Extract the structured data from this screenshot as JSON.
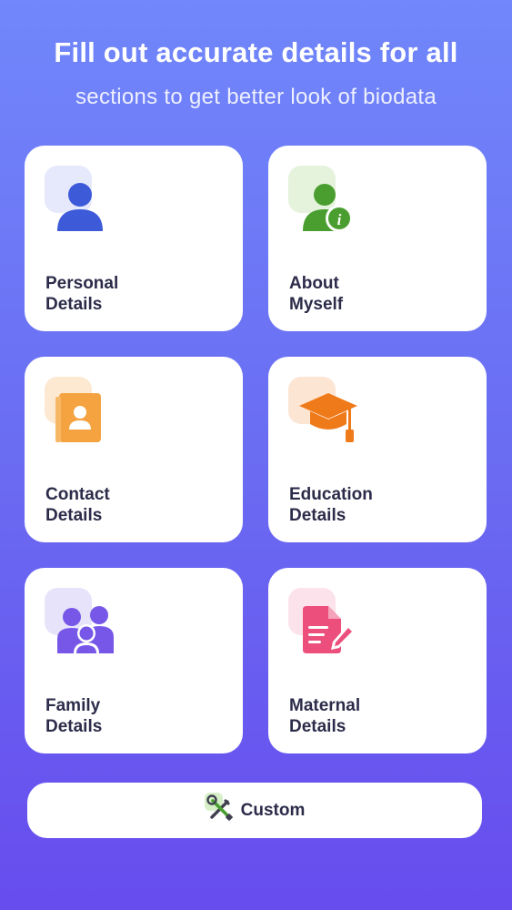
{
  "header": {
    "title": "Fill out accurate details for all",
    "subtitle": "sections to get better look of biodata"
  },
  "cards": [
    {
      "line1": "Personal",
      "line2": "Details",
      "icon": "person-icon",
      "color": "#3d5bd9"
    },
    {
      "line1": "About",
      "line2": "Myself",
      "icon": "person-info-icon",
      "color": "#4a9e2f"
    },
    {
      "line1": "Contact",
      "line2": "Details",
      "icon": "contact-book-icon",
      "color": "#f4a340"
    },
    {
      "line1": "Education",
      "line2": "Details",
      "icon": "graduation-cap-icon",
      "color": "#ef7a1a"
    },
    {
      "line1": "Family",
      "line2": "Details",
      "icon": "family-icon",
      "color": "#7657e8"
    },
    {
      "line1": "Maternal",
      "line2": "Details",
      "icon": "document-edit-icon",
      "color": "#ec4f7c"
    }
  ],
  "custom_button": {
    "label": "Custom",
    "icon": "tools-icon"
  }
}
